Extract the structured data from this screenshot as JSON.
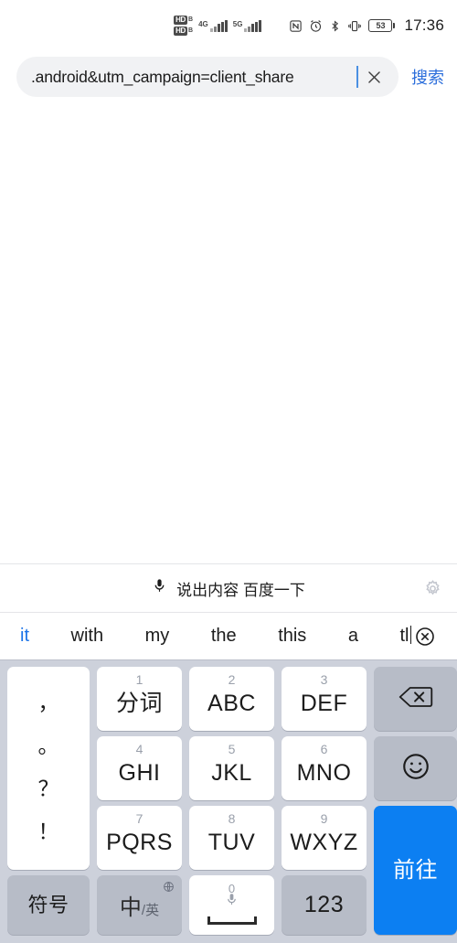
{
  "status_bar": {
    "hd_label": "HD",
    "hd_sub": "B",
    "sim1_network": "4G",
    "sim2_network": "5G",
    "icons": [
      "nfc-icon",
      "alarm-icon",
      "bluetooth-icon",
      "vibrate-icon"
    ],
    "battery_percent": "53",
    "time": "17:36"
  },
  "search": {
    "value": ".android&utm_campaign=client_share",
    "clear_label": "×",
    "action_label": "搜索"
  },
  "keyboard": {
    "voice_bar": {
      "mic_icon": "microphone-icon",
      "hint": "说出内容 百度一下",
      "settings_icon": "gear-icon"
    },
    "suggestions": [
      {
        "text": "it",
        "active": true
      },
      {
        "text": "with",
        "active": false
      },
      {
        "text": "my",
        "active": false
      },
      {
        "text": "the",
        "active": false
      },
      {
        "text": "this",
        "active": false
      },
      {
        "text": "a",
        "active": false
      },
      {
        "text": "tl",
        "active": false
      }
    ],
    "suggestions_close_icon": "close-circle-icon",
    "punctuation_key": [
      "，",
      "。",
      "？",
      "！"
    ],
    "keys": [
      {
        "num": "1",
        "main": "分词",
        "style": "white"
      },
      {
        "num": "2",
        "main": "ABC",
        "style": "white"
      },
      {
        "num": "3",
        "main": "DEF",
        "style": "white"
      },
      {
        "num": "4",
        "main": "GHI",
        "style": "white"
      },
      {
        "num": "5",
        "main": "JKL",
        "style": "white"
      },
      {
        "num": "6",
        "main": "MNO",
        "style": "white"
      },
      {
        "num": "7",
        "main": "PQRS",
        "style": "white"
      },
      {
        "num": "8",
        "main": "TUV",
        "style": "white"
      },
      {
        "num": "9",
        "main": "WXYZ",
        "style": "white"
      }
    ],
    "backspace_icon": "backspace-icon",
    "emoji_icon": "emoji-smiley-icon",
    "enter_label": "前往",
    "symbols_label": "符号",
    "lang_cn": "中",
    "lang_sep": "/",
    "lang_en": "英",
    "lang_globe_icon": "globe-icon",
    "space_zero": "0",
    "space_mic_icon": "microphone-icon",
    "numeric_label": "123"
  },
  "colors": {
    "accent_blue": "#0c7ff2",
    "link_blue": "#2a6ddb",
    "suggestion_blue": "#1a73e8",
    "keyboard_bg": "#cdd1db",
    "key_gray": "#b7bcc7",
    "search_pill": "#f1f2f4"
  }
}
